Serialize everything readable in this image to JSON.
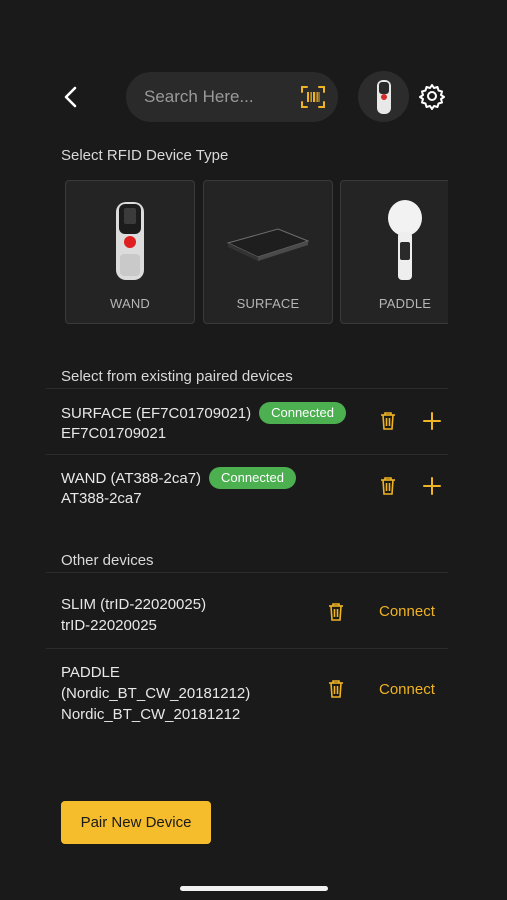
{
  "header": {
    "search_placeholder": "Search Here..."
  },
  "sections": {
    "device_type_title": "Select RFID Device Type",
    "paired_title": "Select from existing paired devices",
    "other_title": "Other devices"
  },
  "device_types": [
    {
      "label": "WAND"
    },
    {
      "label": "SURFACE"
    },
    {
      "label": "PADDLE"
    }
  ],
  "paired_devices": [
    {
      "name": "SURFACE (EF7C01709021)",
      "id": "EF7C01709021",
      "status": "Connected"
    },
    {
      "name": "WAND (AT388-2ca7)",
      "id": "AT388-2ca7",
      "status": "Connected"
    }
  ],
  "other_devices": [
    {
      "line1": "SLIM (trID-22020025)",
      "line2": "trID-22020025",
      "line3": "",
      "action": "Connect"
    },
    {
      "line1": "PADDLE",
      "line2": "(Nordic_BT_CW_20181212)",
      "line3": "Nordic_BT_CW_20181212",
      "action": "Connect"
    }
  ],
  "footer": {
    "pair_button": "Pair New Device"
  },
  "colors": {
    "background": "#1a1a1a",
    "accent": "#f0b323",
    "connected": "#4caf50"
  },
  "icons": [
    "chevron-left-icon",
    "barcode-scan-icon",
    "gear-icon",
    "trash-icon",
    "plus-icon"
  ]
}
